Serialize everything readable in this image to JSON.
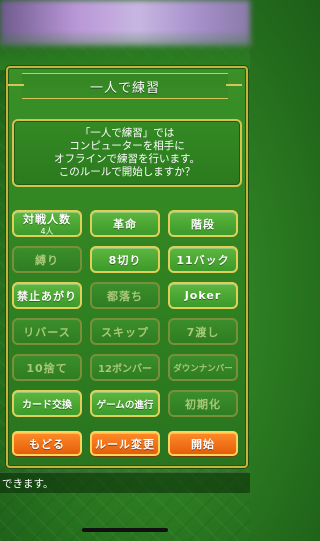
{
  "title": "一人で練習",
  "message": "「一人で練習」では\nコンピューターを相手に\nオフラインで練習を行います。\nこのルールで開始しますか？",
  "rules": [
    {
      "label": "対戦人数",
      "sub": "4人",
      "enabled": true
    },
    {
      "label": "革命",
      "enabled": true
    },
    {
      "label": "階段",
      "enabled": true
    },
    {
      "label": "縛り",
      "enabled": false
    },
    {
      "label": "8切り",
      "enabled": true
    },
    {
      "label": "11バック",
      "enabled": true
    },
    {
      "label": "禁止あがり",
      "enabled": true
    },
    {
      "label": "都落ち",
      "enabled": false
    },
    {
      "label": "Joker",
      "enabled": true
    },
    {
      "label": "リバース",
      "enabled": false
    },
    {
      "label": "スキップ",
      "enabled": false
    },
    {
      "label": "7渡し",
      "enabled": false
    },
    {
      "label": "10捨て",
      "enabled": false
    },
    {
      "label": "12ボンバー",
      "enabled": false
    },
    {
      "label": "ダウンナンバー",
      "enabled": false
    },
    {
      "label": "カード交換",
      "enabled": true
    },
    {
      "label": "ゲームの進行",
      "enabled": true
    },
    {
      "label": "初期化",
      "enabled": false
    }
  ],
  "actions": {
    "back": "もどる",
    "change_rules": "ルール変更",
    "start": "開始"
  },
  "info": "できます。"
}
